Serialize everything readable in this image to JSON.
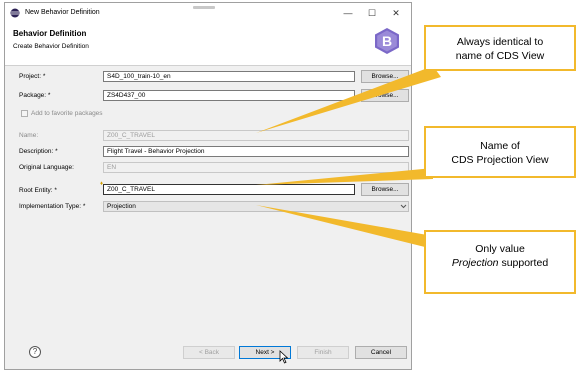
{
  "window": {
    "title": "New Behavior Definition",
    "header_title": "Behavior Definition",
    "header_subtitle": "Create Behavior Definition",
    "controls": {
      "minimize": "—",
      "maximize": "☐",
      "close": "✕"
    }
  },
  "form": {
    "project_label": "Project: *",
    "project_value": "S4D_100_train-10_en",
    "project_button": "Browse...",
    "package_label": "Package: *",
    "package_value": "ZS4D437_00",
    "package_button": "Browse...",
    "favorites_label": "Add to favorite packages",
    "name_label": "Name:",
    "name_value": "Z00_C_TRAVEL",
    "description_label": "Description: *",
    "description_value": "Flight Travel - Behavior Projection",
    "language_label": "Original Language:",
    "language_value": "EN",
    "root_entity_label": "Root Entity: *",
    "root_entity_value": "Z00_C_TRAVEL",
    "root_entity_button": "Browse...",
    "impl_type_label": "Implementation Type: *",
    "impl_type_value": "Projection"
  },
  "footer": {
    "help": "?",
    "back": "< Back",
    "next": "Next >",
    "finish": "Finish",
    "cancel": "Cancel"
  },
  "callouts": {
    "name": [
      "Always identical to",
      "name of CDS View"
    ],
    "root": [
      "Name of",
      "CDS Projection View"
    ],
    "impl": [
      "Only value",
      "Projection",
      "supported"
    ]
  },
  "colors": {
    "callout_border": "#f2b92c",
    "arrow": "#f2b92c",
    "b_icon": "#7b68c8"
  }
}
